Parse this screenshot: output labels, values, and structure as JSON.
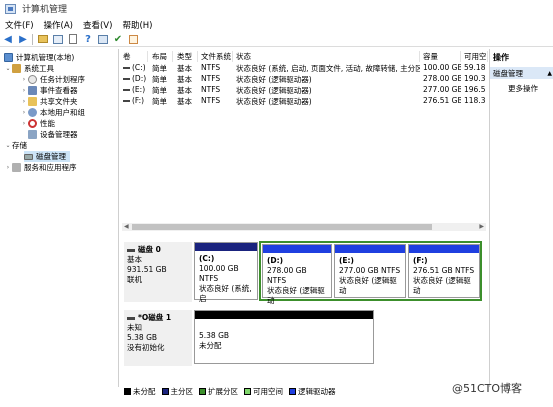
{
  "window": {
    "title": "计算机管理"
  },
  "menu": [
    "文件(F)",
    "操作(A)",
    "查看(V)",
    "帮助(H)"
  ],
  "toolbar_icons": [
    "back-icon",
    "forward-icon",
    "up-folder-icon",
    "show-hide-tree-icon",
    "properties-icon",
    "help-icon",
    "refresh-icon",
    "check-icon",
    "delete-icon"
  ],
  "tree": {
    "root": "计算机管理(本地)",
    "sys_tools": "系统工具",
    "items": [
      "任务计划程序",
      "事件查看器",
      "共享文件夹",
      "本地用户和组",
      "性能",
      "设备管理器"
    ],
    "storage": "存储",
    "disk_mgmt": "磁盘管理",
    "services": "服务和应用程序"
  },
  "volume_table": {
    "headers": [
      "卷",
      "布局",
      "类型",
      "文件系统",
      "状态",
      "容量",
      "可用空"
    ],
    "rows": [
      [
        "(C:)",
        "简单",
        "基本",
        "NTFS",
        "状态良好 (系统, 启动, 页面文件, 活动, 故障转储, 主分区)",
        "100.00 GB",
        "59.18"
      ],
      [
        "(D:)",
        "简单",
        "基本",
        "NTFS",
        "状态良好 (逻辑驱动器)",
        "278.00 GB",
        "190.3"
      ],
      [
        "(E:)",
        "简单",
        "基本",
        "NTFS",
        "状态良好 (逻辑驱动器)",
        "277.00 GB",
        "196.5"
      ],
      [
        "(F:)",
        "简单",
        "基本",
        "NTFS",
        "状态良好 (逻辑驱动器)",
        "276.51 GB",
        "118.3"
      ]
    ]
  },
  "disks": [
    {
      "name": "磁盘 0",
      "type": "基本",
      "size": "931.51 GB",
      "status": "联机",
      "partitions": [
        {
          "label": "(C:)",
          "size": "100.00 GB NTFS",
          "status": "状态良好 (系统, 启"
        },
        {
          "label": "(D:)",
          "size": "278.00 GB NTFS",
          "status": "状态良好 (逻辑驱动"
        },
        {
          "label": "(E:)",
          "size": "277.00 GB NTFS",
          "status": "状态良好 (逻辑驱动"
        },
        {
          "label": "(F:)",
          "size": "276.51 GB NTFS",
          "status": "状态良好 (逻辑驱动"
        }
      ]
    },
    {
      "name": "*O磁盘 1",
      "type": "未知",
      "size": "5.38 GB",
      "status": "没有初始化",
      "partitions": [
        {
          "size": "5.38 GB",
          "status": "未分配"
        }
      ]
    }
  ],
  "legend": [
    "未分配",
    "主分区",
    "扩展分区",
    "可用空间",
    "逻辑驱动器"
  ],
  "colors": {
    "unallocated": "#000000",
    "primary": "#1a237e",
    "extended": "#3c8f2c",
    "free": "#7fd66b",
    "logical": "#1f3fe0"
  },
  "actions": {
    "header": "操作",
    "selected": "磁盘管理",
    "more": "更多操作"
  },
  "watermark": "@51CTO博客"
}
